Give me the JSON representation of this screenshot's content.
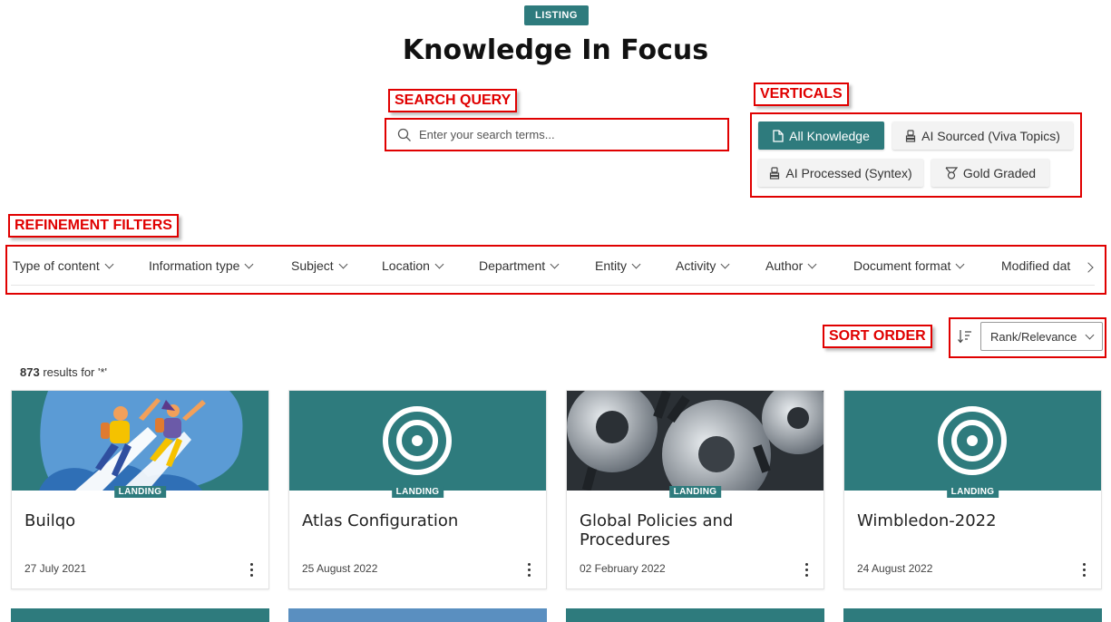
{
  "header": {
    "badge": "LISTING",
    "title": "Knowledge In Focus"
  },
  "annotations": {
    "search_query": "SEARCH QUERY",
    "verticals": "VERTICALS",
    "refinement_filters": "REFINEMENT FILTERS",
    "sort_order": "SORT ORDER"
  },
  "search": {
    "placeholder": "Enter your search terms...",
    "icon": "search-icon"
  },
  "verticals": [
    {
      "label": "All Knowledge",
      "icon": "document-icon",
      "active": true
    },
    {
      "label": "AI Sourced (Viva Topics)",
      "icon": "stack-icon",
      "active": false
    },
    {
      "label": "AI Processed (Syntex)",
      "icon": "stack-icon",
      "active": false
    },
    {
      "label": "Gold Graded",
      "icon": "medal-icon",
      "active": false
    }
  ],
  "filters": [
    "Type of content",
    "Information type",
    "Subject",
    "Location",
    "Department",
    "Entity",
    "Activity",
    "Author",
    "Document format",
    "Modified dat"
  ],
  "sort": {
    "icon": "sort-icon",
    "selected": "Rank/Relevance"
  },
  "results": {
    "count": "873",
    "suffix": " results for '*'"
  },
  "cards": [
    {
      "badge": "LANDING",
      "title": "Builqo",
      "date": "27 July 2021",
      "image": "people-flying-illustration"
    },
    {
      "badge": "LANDING",
      "title": "Atlas Configuration",
      "date": "25 August 2022",
      "image": "target-icon"
    },
    {
      "badge": "LANDING",
      "title": "Global Policies and Procedures",
      "date": "02 February 2022",
      "image": "gears-photo"
    },
    {
      "badge": "LANDING",
      "title": "Wimbledon-2022",
      "date": "24 August 2022",
      "image": "target-icon"
    }
  ],
  "colors": {
    "accent": "#2e7b7d",
    "annotation": "#e00000"
  }
}
